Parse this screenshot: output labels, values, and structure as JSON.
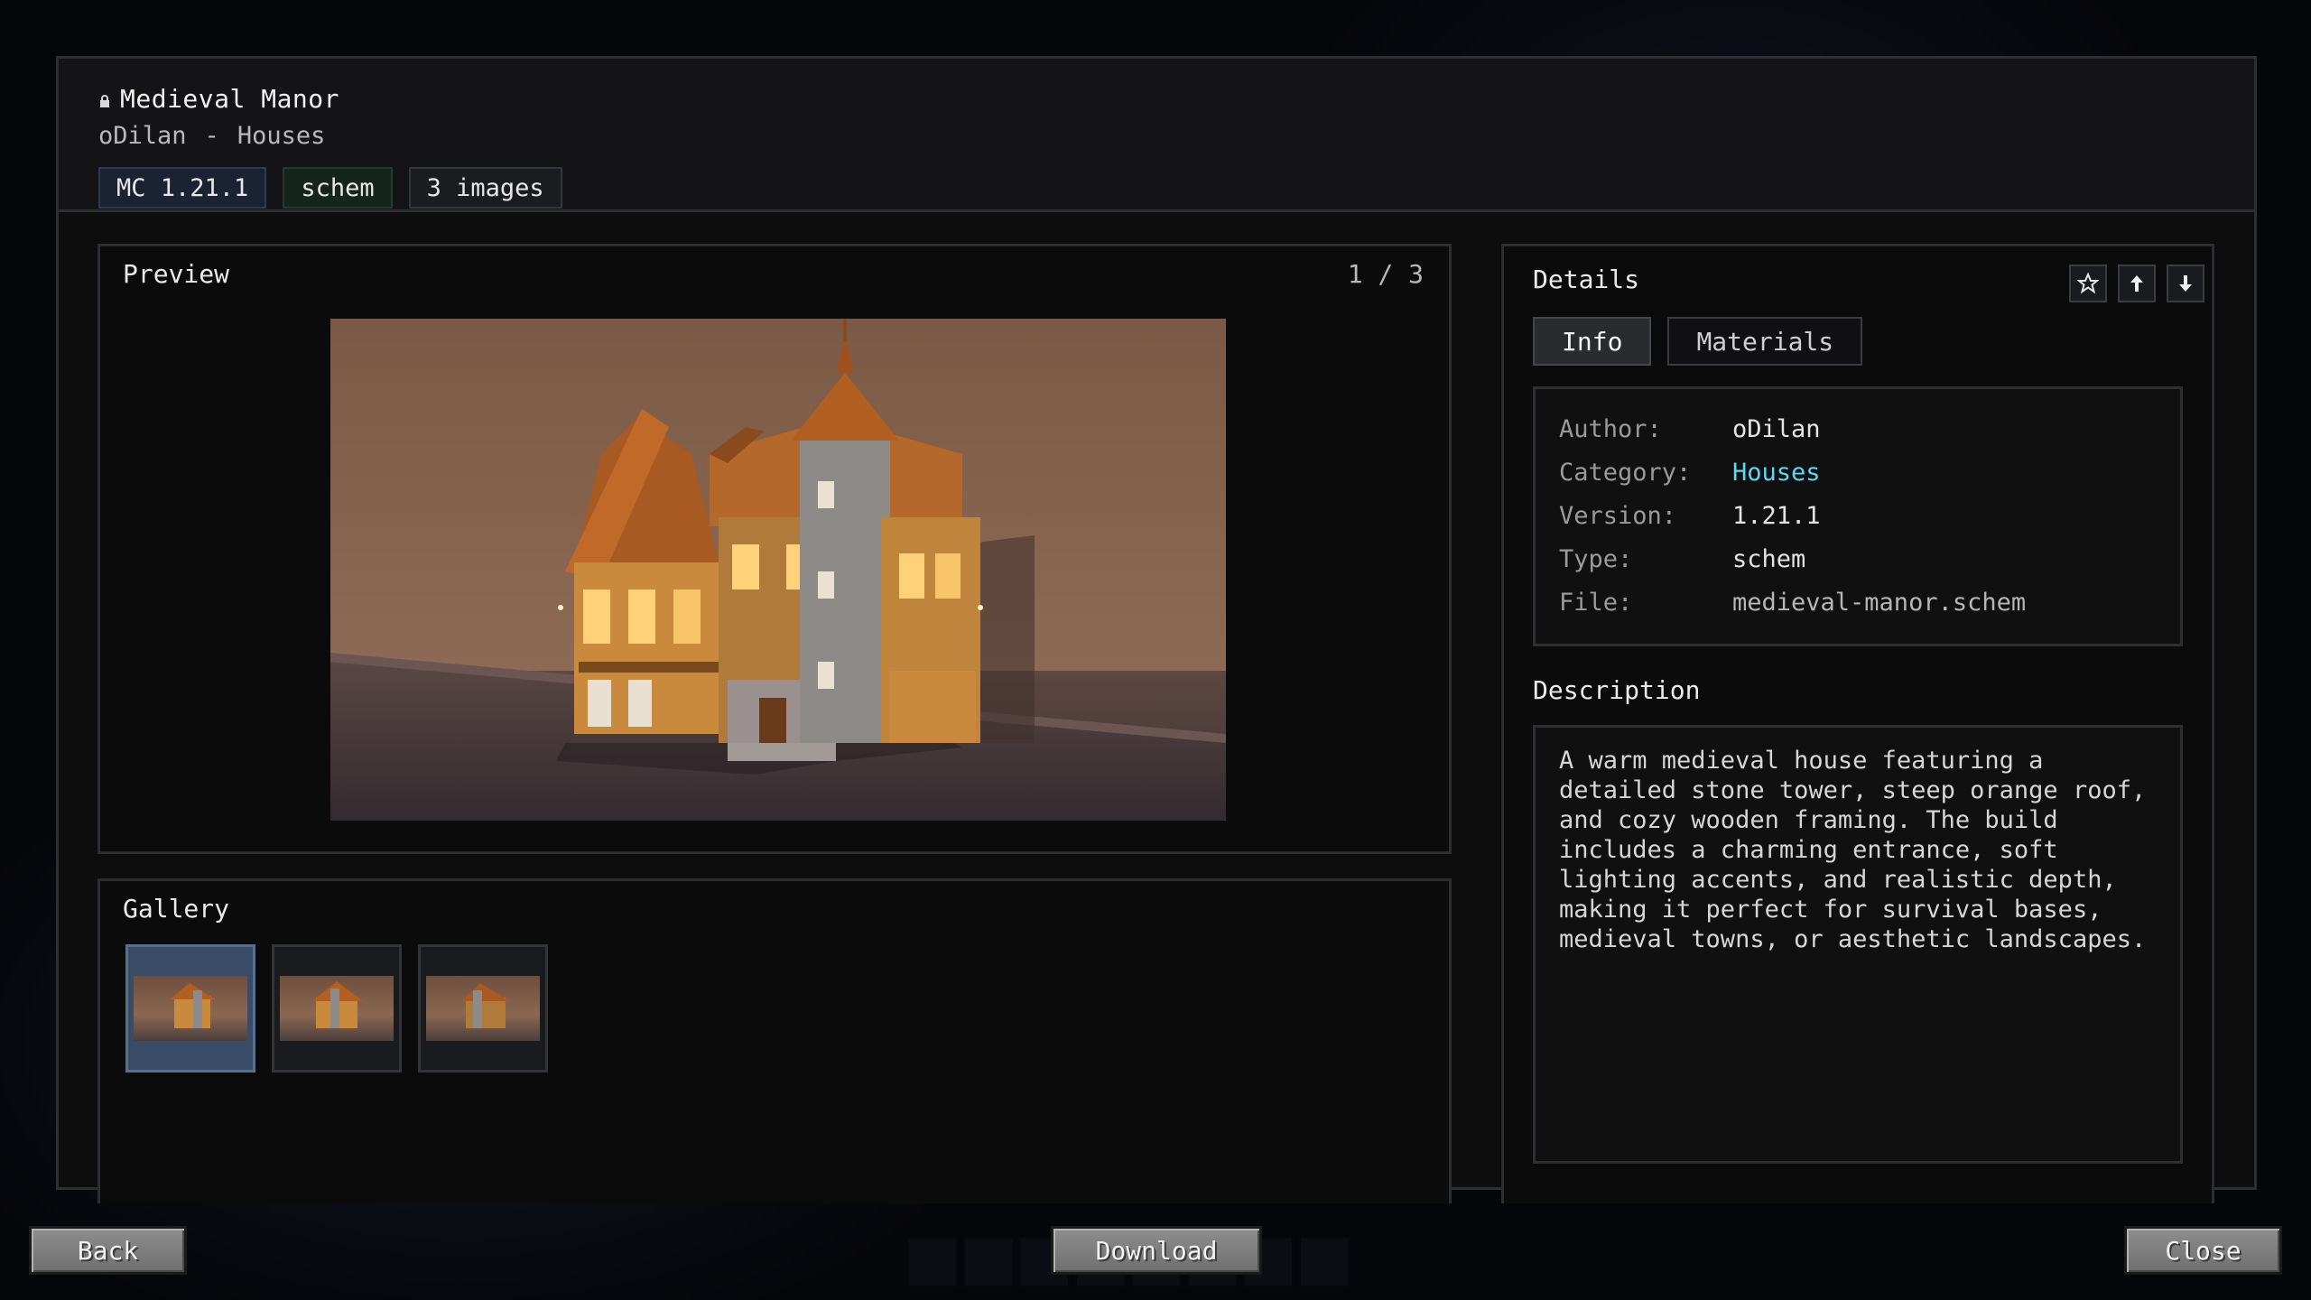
{
  "header": {
    "title": "Medieval Manor",
    "author": "oDilan",
    "separator": "-",
    "category": "Houses",
    "chips": [
      "MC 1.21.1",
      "schem",
      "3 images"
    ]
  },
  "preview": {
    "title": "Preview",
    "counter": "1 / 3"
  },
  "gallery": {
    "title": "Gallery",
    "thumbnail_count": 3,
    "selected_index": 0
  },
  "details": {
    "title": "Details",
    "icons": [
      "star-icon",
      "arrow-up-icon",
      "arrow-down-icon"
    ],
    "tabs": [
      {
        "label": "Info",
        "active": true
      },
      {
        "label": "Materials",
        "active": false
      }
    ],
    "info": [
      {
        "label": "Author:",
        "value": "oDilan"
      },
      {
        "label": "Category:",
        "value": "Houses"
      },
      {
        "label": "Version:",
        "value": "1.21.1"
      },
      {
        "label": "Type:",
        "value": "schem"
      },
      {
        "label": "File:",
        "value": "medieval-manor.schem"
      }
    ],
    "description_title": "Description",
    "description": "A warm medieval house featuring a detailed stone tower, steep orange roof, and cozy wooden framing. The build includes a charming entrance, soft lighting accents, and realistic depth, making it perfect for survival bases, medieval towns, or aesthetic landscapes."
  },
  "footer": {
    "back": "Back",
    "download": "Download",
    "close": "Close"
  },
  "colors": {
    "link": "#5fd7f0",
    "chip_version_bg": "#1b2233",
    "chip_type_bg": "#16241e",
    "gallery_selected_bg": "#3a4b66"
  }
}
